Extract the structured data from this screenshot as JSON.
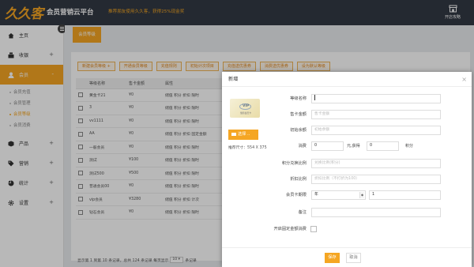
{
  "header": {
    "logo_text": "久久客",
    "platform": "会员营销云平台",
    "promo": "推荐朋友使用久久客，获得25%现金奖",
    "store_label": "开店攻略"
  },
  "sidebar": {
    "items": [
      {
        "label": "主页"
      },
      {
        "label": "收银",
        "expand": "+"
      },
      {
        "label": "会员",
        "expand": "-"
      },
      {
        "label": "产品",
        "expand": "+"
      },
      {
        "label": "营销",
        "expand": "+"
      },
      {
        "label": "统计",
        "expand": "+"
      },
      {
        "label": "设置",
        "expand": "+"
      }
    ],
    "member_sub": [
      "会员充值",
      "会员管理",
      "会员等级",
      "会员消费"
    ]
  },
  "tab": {
    "label": "会员等级"
  },
  "toolbar": {
    "buttons": [
      "新建会员等级 +",
      "开通会员等级",
      "充值规则",
      "初始计次项目",
      "充值送优惠券",
      "消费送优惠券",
      "设为默认等级"
    ]
  },
  "table": {
    "headers": [
      "",
      "等级名称",
      "售卡金额",
      "属性"
    ],
    "rows": [
      {
        "name": "黄金卡21",
        "price": "¥0",
        "attr": "储值 积分 折扣 限时",
        "red": false
      },
      {
        "name": "3",
        "price": "¥0",
        "attr": "储值 积分 折扣 限时",
        "red": false
      },
      {
        "name": "vv1111",
        "price": "¥0",
        "attr": "储值 积分 折扣 限时",
        "red": false
      },
      {
        "name": "AA",
        "price": "¥0",
        "attr": "储值 积分 折扣 固定金额",
        "red": false
      },
      {
        "name": "一般会员",
        "price": "¥0",
        "attr": "储值 积分 折扣 限时",
        "red": false
      },
      {
        "name": "测试",
        "price": "¥100",
        "attr": "储值 积分 折扣 限时",
        "red": true
      },
      {
        "name": "测试500",
        "price": "¥500",
        "attr": "储值 积分 折扣 限时",
        "red": true
      },
      {
        "name": "普通会员00",
        "price": "¥0",
        "attr": "储值 积分 折扣 限时",
        "red": false
      },
      {
        "name": "vip会员",
        "price": "¥3280",
        "attr": "储值 积分 折扣 计次",
        "red": true
      },
      {
        "name": "钻石会员",
        "price": "¥0",
        "attr": "储值 积分 折扣 限时",
        "red": false
      }
    ]
  },
  "pager": {
    "text": "显示第 1 到第 10 条记录，总共 124 条记录 每页显示",
    "size": "10",
    "suffix": "条记录"
  },
  "modal": {
    "title": "新增",
    "close": "×",
    "card_vip": "VIP",
    "card_sub": "储值会员卡",
    "upload_label": "选择 ..",
    "size_note": "推荐尺寸：554 X 375",
    "fields": {
      "level_name": {
        "label": "等级名称",
        "value": "",
        "placeholder": ""
      },
      "card_price": {
        "label": "售卡金额",
        "placeholder": "售卡金额"
      },
      "initial_balance": {
        "label": "初始余额",
        "placeholder": "初始余额"
      },
      "consume": {
        "label": "消费",
        "amount": "0",
        "unit": "元,获得",
        "points": "0",
        "points_unit": "积分"
      },
      "points_ratio": {
        "label": "积分兑换比例",
        "placeholder": "兑换比例(积分)"
      },
      "discount": {
        "label": "折扣比例",
        "placeholder": "折扣比例（不打折为100）"
      },
      "validity": {
        "label": "会员卡期限",
        "unit": "年",
        "value": "1"
      },
      "remark": {
        "label": "备注",
        "placeholder": ""
      },
      "fixed_amount": {
        "label": "开启固定金额消费"
      }
    },
    "save_label": "保存",
    "cancel_label": "取消"
  }
}
